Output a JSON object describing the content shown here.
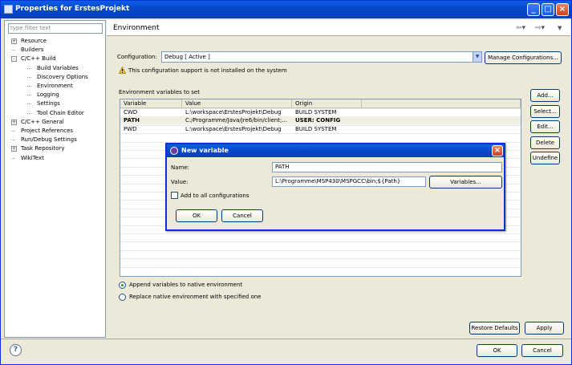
{
  "window": {
    "title": "Properties for ErstesProjekt"
  },
  "sidebar": {
    "filter_placeholder": "type filter text",
    "items": [
      {
        "label": "Resource",
        "level": 0,
        "toggle": "+"
      },
      {
        "label": "Builders",
        "level": 0,
        "toggle": ""
      },
      {
        "label": "C/C++ Build",
        "level": 0,
        "toggle": "-"
      },
      {
        "label": "Build Variables",
        "level": 1,
        "toggle": ""
      },
      {
        "label": "Discovery Options",
        "level": 1,
        "toggle": ""
      },
      {
        "label": "Environment",
        "level": 1,
        "toggle": ""
      },
      {
        "label": "Logging",
        "level": 1,
        "toggle": ""
      },
      {
        "label": "Settings",
        "level": 1,
        "toggle": ""
      },
      {
        "label": "Tool Chain Editor",
        "level": 1,
        "toggle": ""
      },
      {
        "label": "C/C++ General",
        "level": 0,
        "toggle": "+"
      },
      {
        "label": "Project References",
        "level": 0,
        "toggle": ""
      },
      {
        "label": "Run/Debug Settings",
        "level": 0,
        "toggle": ""
      },
      {
        "label": "Task Repository",
        "level": 0,
        "toggle": "+"
      },
      {
        "label": "WikiText",
        "level": 0,
        "toggle": ""
      }
    ]
  },
  "main": {
    "title": "Environment",
    "configuration_label": "Configuration:",
    "configuration_value": "Debug [ Active ]",
    "manage_label": "Manage Configurations...",
    "warning": "This configuration support is not installed on the system",
    "table_label": "Environment variables to set",
    "columns": [
      "Variable",
      "Value",
      "Origin"
    ],
    "rows": [
      {
        "variable": "CWD",
        "value": "L:\\workspace\\ErstesProjekt\\Debug",
        "origin": "BUILD SYSTEM",
        "bold": false
      },
      {
        "variable": "PATH",
        "value": "C:/Programme/Java/jre6/bin/client;...",
        "origin": "USER: CONFIG",
        "bold": true
      },
      {
        "variable": "PWD",
        "value": "L:\\workspace\\ErstesProjekt\\Debug",
        "origin": "BUILD SYSTEM",
        "bold": false
      }
    ],
    "buttons": [
      "Add...",
      "Select...",
      "Edit...",
      "Delete",
      "Undefine"
    ],
    "radio_append": "Append variables to native environment",
    "radio_replace": "Replace native environment with specified one",
    "restore_defaults": "Restore Defaults",
    "apply": "Apply"
  },
  "footer": {
    "ok": "OK",
    "cancel": "Cancel"
  },
  "dialog": {
    "title": "New variable",
    "name_label": "Name:",
    "name_value": "PATH",
    "value_label": "Value:",
    "value_value": "L:\\Programme\\MSP430\\MSPGCC\\bin;${Path}",
    "variables_label": "Variables...",
    "add_all_label": "Add to all configurations",
    "ok": "OK",
    "cancel": "Cancel"
  }
}
